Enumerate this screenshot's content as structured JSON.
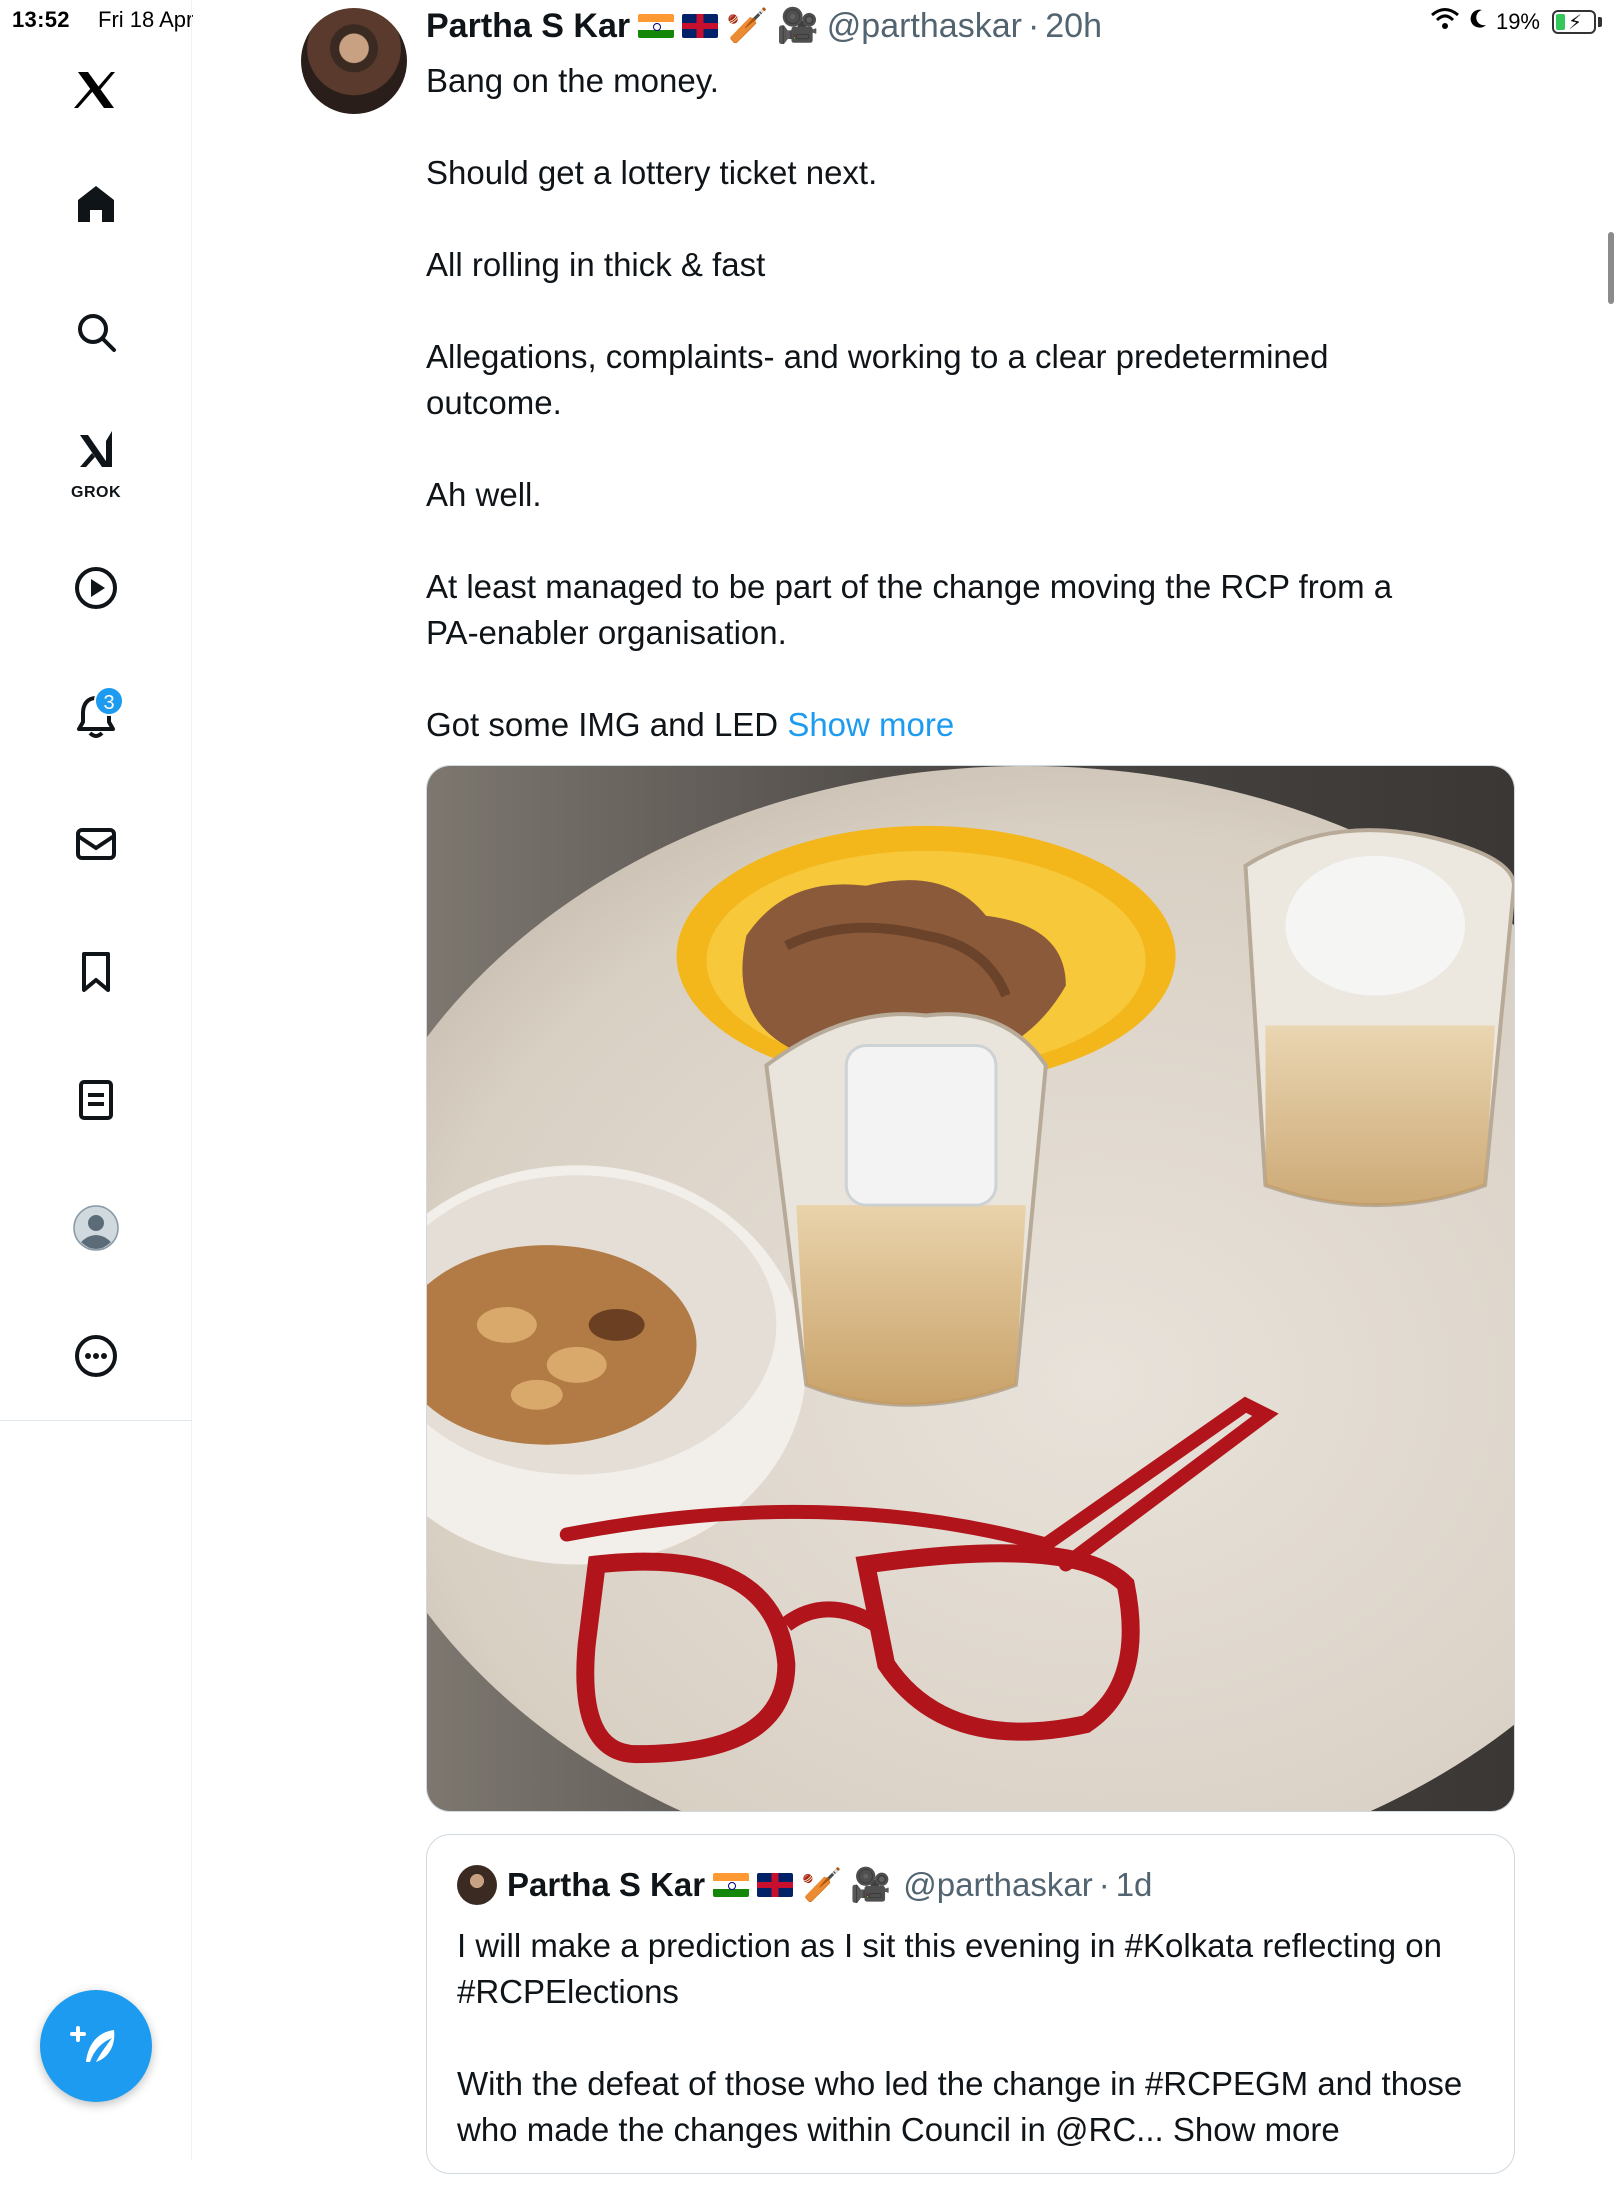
{
  "status_bar": {
    "time": "13:52",
    "date": "Fri 18 Apr",
    "battery": "19%"
  },
  "sidebar": {
    "items": [
      {
        "name": "x-logo-icon"
      },
      {
        "name": "home-icon"
      },
      {
        "name": "search-icon"
      },
      {
        "name": "grok-icon",
        "label": "GROK"
      },
      {
        "name": "video-icon"
      },
      {
        "name": "notifications-icon",
        "badge": "3"
      },
      {
        "name": "messages-icon"
      },
      {
        "name": "bookmarks-icon"
      },
      {
        "name": "lists-icon"
      },
      {
        "name": "profile-icon"
      },
      {
        "name": "more-icon"
      }
    ],
    "compose": {
      "name": "compose-icon"
    }
  },
  "post": {
    "author_name": "Partha S Kar",
    "handle": "@parthaskar",
    "dot": "·",
    "age": "20h",
    "emojis": [
      "🏏",
      "🎥"
    ],
    "paragraphs": [
      "Bang on the money.",
      "Should get a lottery ticket next.",
      "All rolling in thick & fast",
      "Allegations, complaints- and working to a clear predetermined outcome.",
      "Ah well.",
      "At least managed to be part of the change moving the RCP from a PA-enabler organisation."
    ],
    "last_line": "Got some IMG and LED ",
    "show_more": "Show more"
  },
  "quote": {
    "author_name": "Partha S Kar",
    "handle": "@parthaskar",
    "dot": "·",
    "age": "1d",
    "emojis": [
      "🏏",
      "🎥"
    ],
    "paragraph1": "I will make a prediction as I sit this evening in #Kolkata reflecting on #RCPElections",
    "paragraph2": "With the defeat of those who led the change in #RCPEGM and those who made the changes within Council in @RC... Show more"
  },
  "colors": {
    "accent": "#1d9bf0",
    "text": "#0f1419",
    "secondary": "#536471",
    "border": "#cfd9de"
  }
}
